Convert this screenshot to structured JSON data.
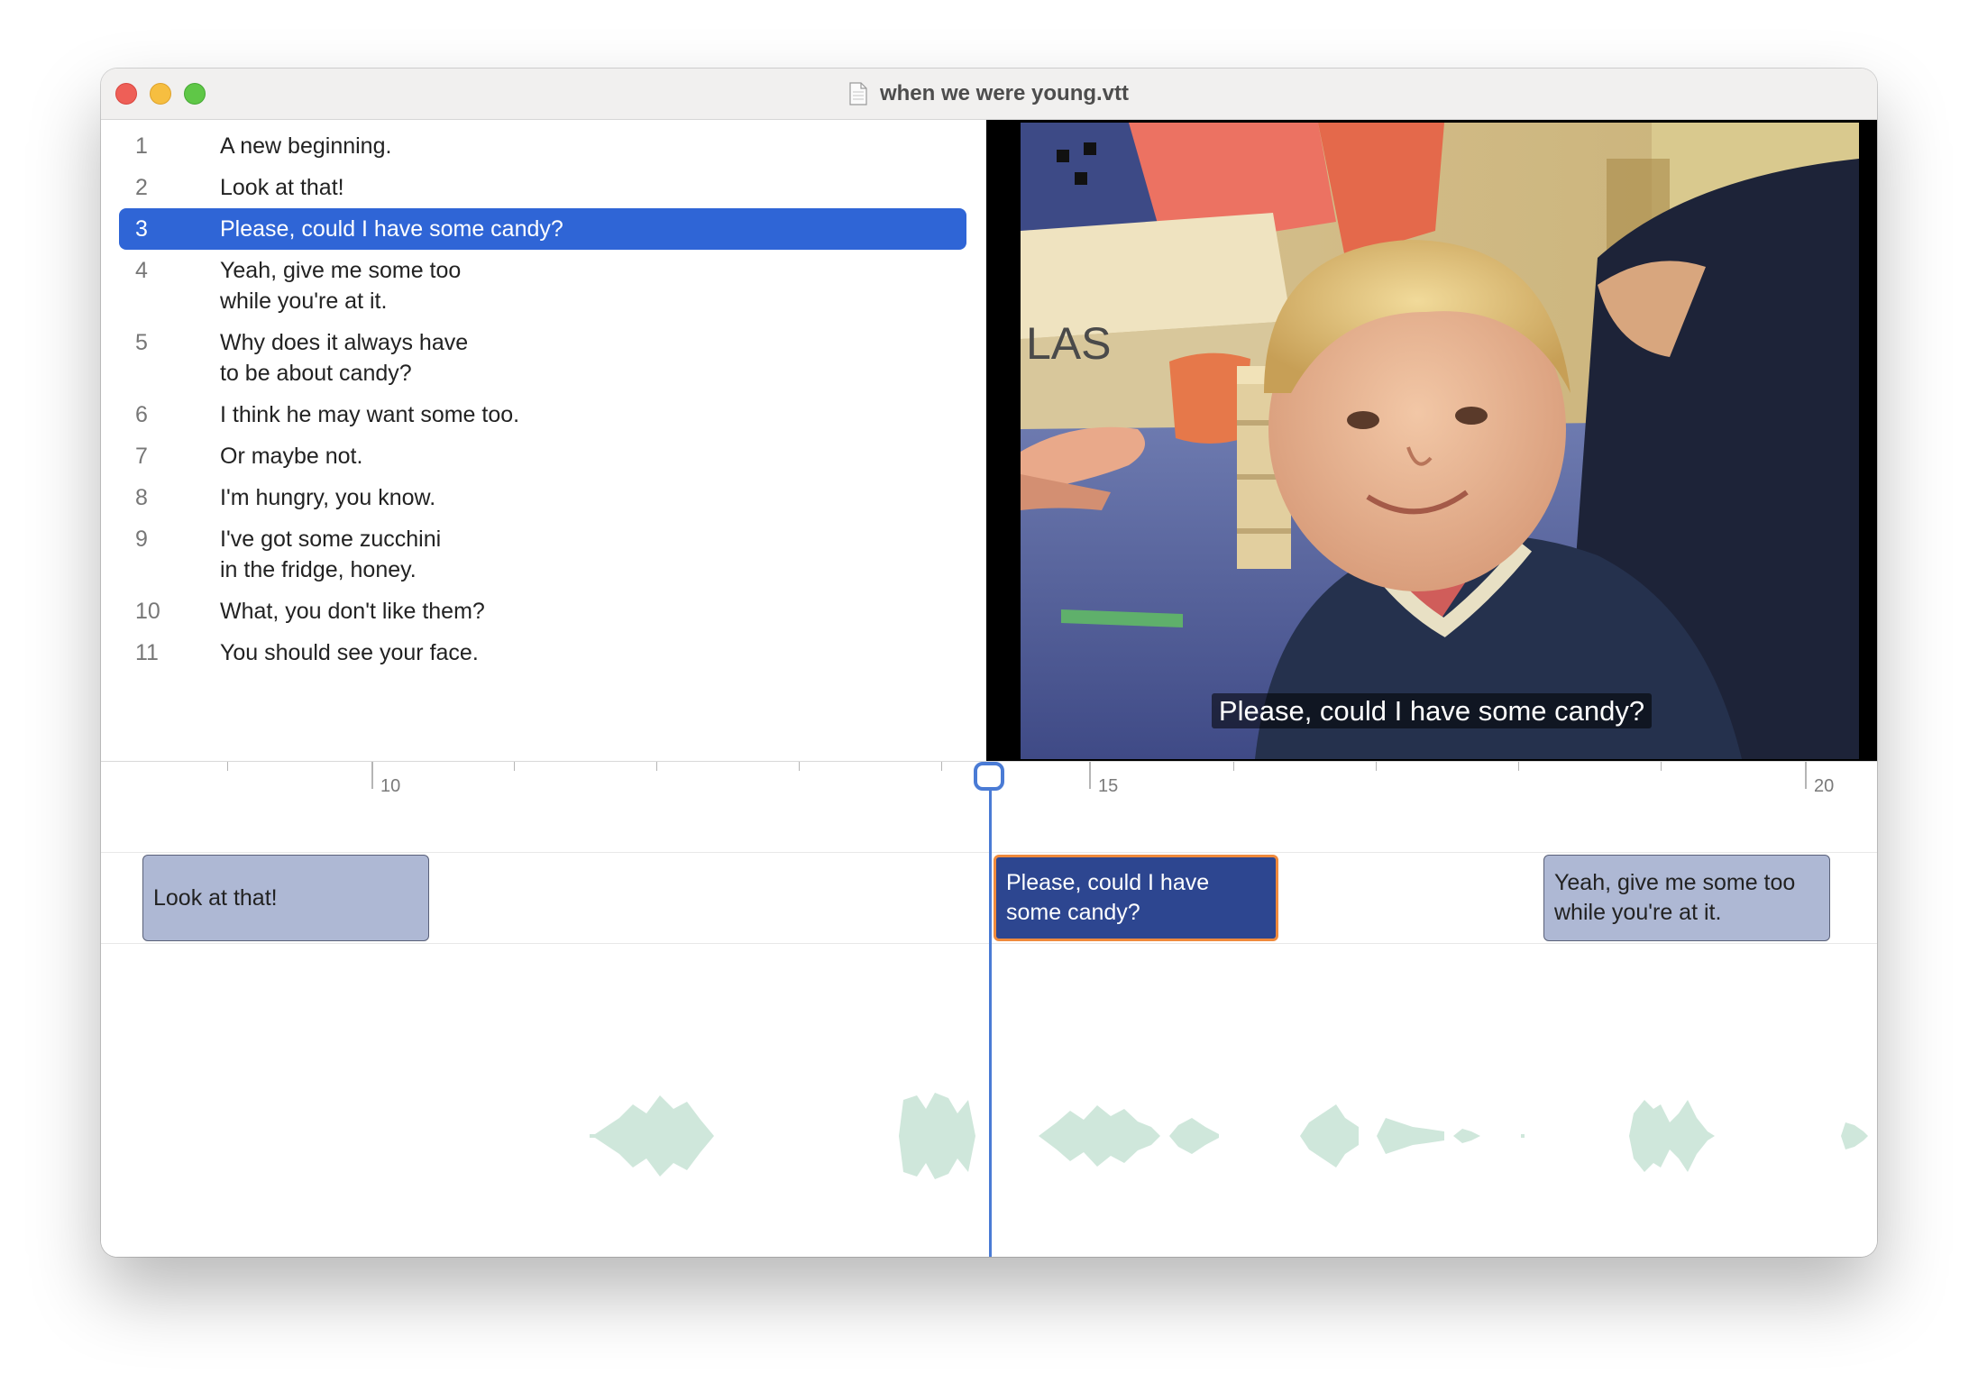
{
  "window": {
    "title": "when we were young.vtt",
    "document_icon": "document-icon"
  },
  "subtitles": [
    {
      "index": "1",
      "text": "A new beginning."
    },
    {
      "index": "2",
      "text": "Look at that!"
    },
    {
      "index": "3",
      "text": "Please, could I have some candy?",
      "selected": true
    },
    {
      "index": "4",
      "text": "Yeah, give me some too\nwhile you're at it."
    },
    {
      "index": "5",
      "text": "Why does it always have\nto be about candy?"
    },
    {
      "index": "6",
      "text": "I think he may want some too."
    },
    {
      "index": "7",
      "text": "Or maybe not."
    },
    {
      "index": "8",
      "text": "I'm hungry, you know."
    },
    {
      "index": "9",
      "text": "I've got some zucchini\nin the fridge, honey."
    },
    {
      "index": "10",
      "text": "What, you don't like them?"
    },
    {
      "index": "11",
      "text": "You should see your face."
    }
  ],
  "video": {
    "caption": "Please, could I have some candy?"
  },
  "timeline": {
    "tick_labels": [
      "10",
      "15",
      "20"
    ],
    "cues": [
      {
        "text": "Look at that!",
        "active": false
      },
      {
        "text": "Please, could I have\nsome candy?",
        "active": true
      },
      {
        "text": "Yeah, give me some too\nwhile you're at it.",
        "active": false
      }
    ]
  },
  "colors": {
    "selection": "#2f65d6",
    "cue_fill": "#aeb8d4",
    "cue_active_fill": "#2d4690",
    "cue_active_border": "#f08a3c",
    "playhead": "#4a7bd5",
    "waveform": "#cfe7db"
  }
}
